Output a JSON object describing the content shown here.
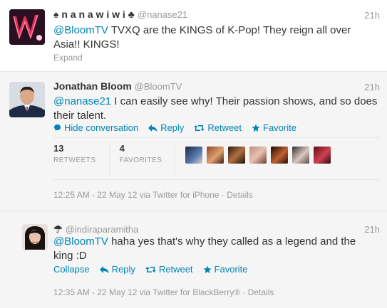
{
  "tweets": [
    {
      "name": "♠ n a n a w i w i ♣",
      "handle": "@nanase21",
      "time": "21h",
      "mention": "@BloomTV",
      "text": " TVXQ are the KINGS of K-Pop! They reign all over Asia!! KINGS!",
      "expand": "Expand"
    },
    {
      "name": "Jonathan Bloom",
      "handle": "@BloomTV",
      "time": "21h",
      "mention": "@nanase21",
      "text": " I can easily see why! Their passion shows, and so does their talent.",
      "actions": {
        "hide": "Hide conversation",
        "reply": "Reply",
        "retweet": "Retweet",
        "favorite": "Favorite"
      },
      "stats": {
        "retweets_count": "13",
        "retweets_label": "RETWEETS",
        "favorites_count": "4",
        "favorites_label": "FAVORITES"
      },
      "meta": "12:25 AM - 22 May 12 via Twitter for iPhone · Details"
    },
    {
      "name": "☂",
      "handle": "@indiraparamitha",
      "time": "21h",
      "mention": "@BloomTV",
      "text": " haha yes that's why they called as a legend and the king :D",
      "actions": {
        "collapse": "Collapse",
        "reply": "Reply",
        "retweet": "Retweet",
        "favorite": "Favorite"
      },
      "meta": "12:35 AM - 22 May 12 via Twitter for BlackBerry® · Details"
    }
  ],
  "colors": {
    "link": "#0084b4",
    "muted": "#999999",
    "text": "#333333"
  },
  "icons": [
    "speech-bubble-icon",
    "reply-arrow-icon",
    "retweet-icon",
    "star-icon"
  ]
}
